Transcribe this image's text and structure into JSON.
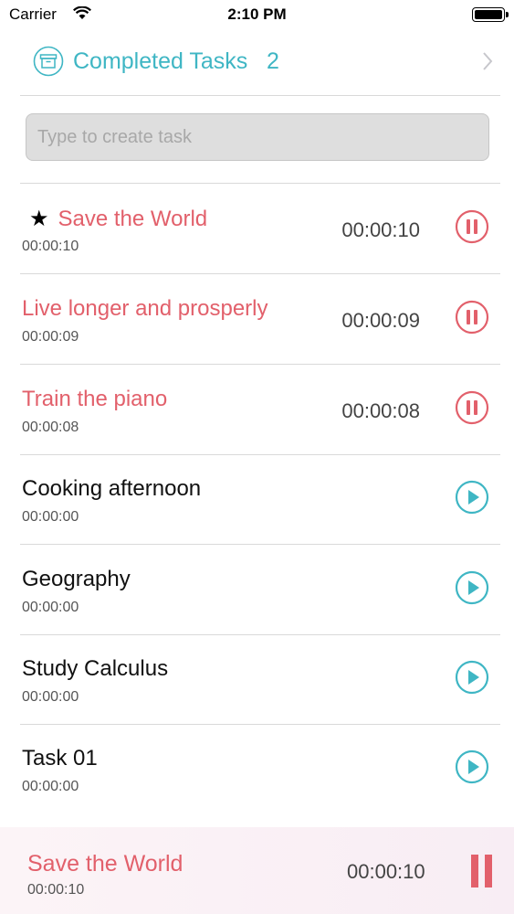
{
  "status_bar": {
    "carrier": "Carrier",
    "time": "2:10 PM"
  },
  "completed": {
    "label": "Completed Tasks",
    "count": "2"
  },
  "create_task": {
    "placeholder": "Type to create task"
  },
  "tasks": [
    {
      "title": "Save the World",
      "subtitle": "00:00:10",
      "timer": "00:00:10",
      "state": "running",
      "starred": true
    },
    {
      "title": "Live longer and prosperly",
      "subtitle": "00:00:09",
      "timer": "00:00:09",
      "state": "running",
      "starred": false
    },
    {
      "title": "Train the piano",
      "subtitle": "00:00:08",
      "timer": "00:00:08",
      "state": "running",
      "starred": false
    },
    {
      "title": "Cooking afternoon",
      "subtitle": "00:00:00",
      "timer": "",
      "state": "idle",
      "starred": false
    },
    {
      "title": "Geography",
      "subtitle": "00:00:00",
      "timer": "",
      "state": "idle",
      "starred": false
    },
    {
      "title": "Study Calculus",
      "subtitle": "00:00:00",
      "timer": "",
      "state": "idle",
      "starred": false
    },
    {
      "title": "Task 01",
      "subtitle": "00:00:00",
      "timer": "",
      "state": "idle",
      "starred": false
    }
  ],
  "now_playing": {
    "title": "Save the World",
    "subtitle": "00:00:10",
    "timer": "00:00:10"
  },
  "colors": {
    "accent": "#3fb6c4",
    "running": "#e2606b",
    "divider": "#d9d9d9"
  },
  "icons": {
    "archive": "archive-box-icon",
    "chevron": "chevron-right-icon",
    "star": "star-icon",
    "pause": "pause-circle-icon",
    "play": "play-circle-icon"
  }
}
